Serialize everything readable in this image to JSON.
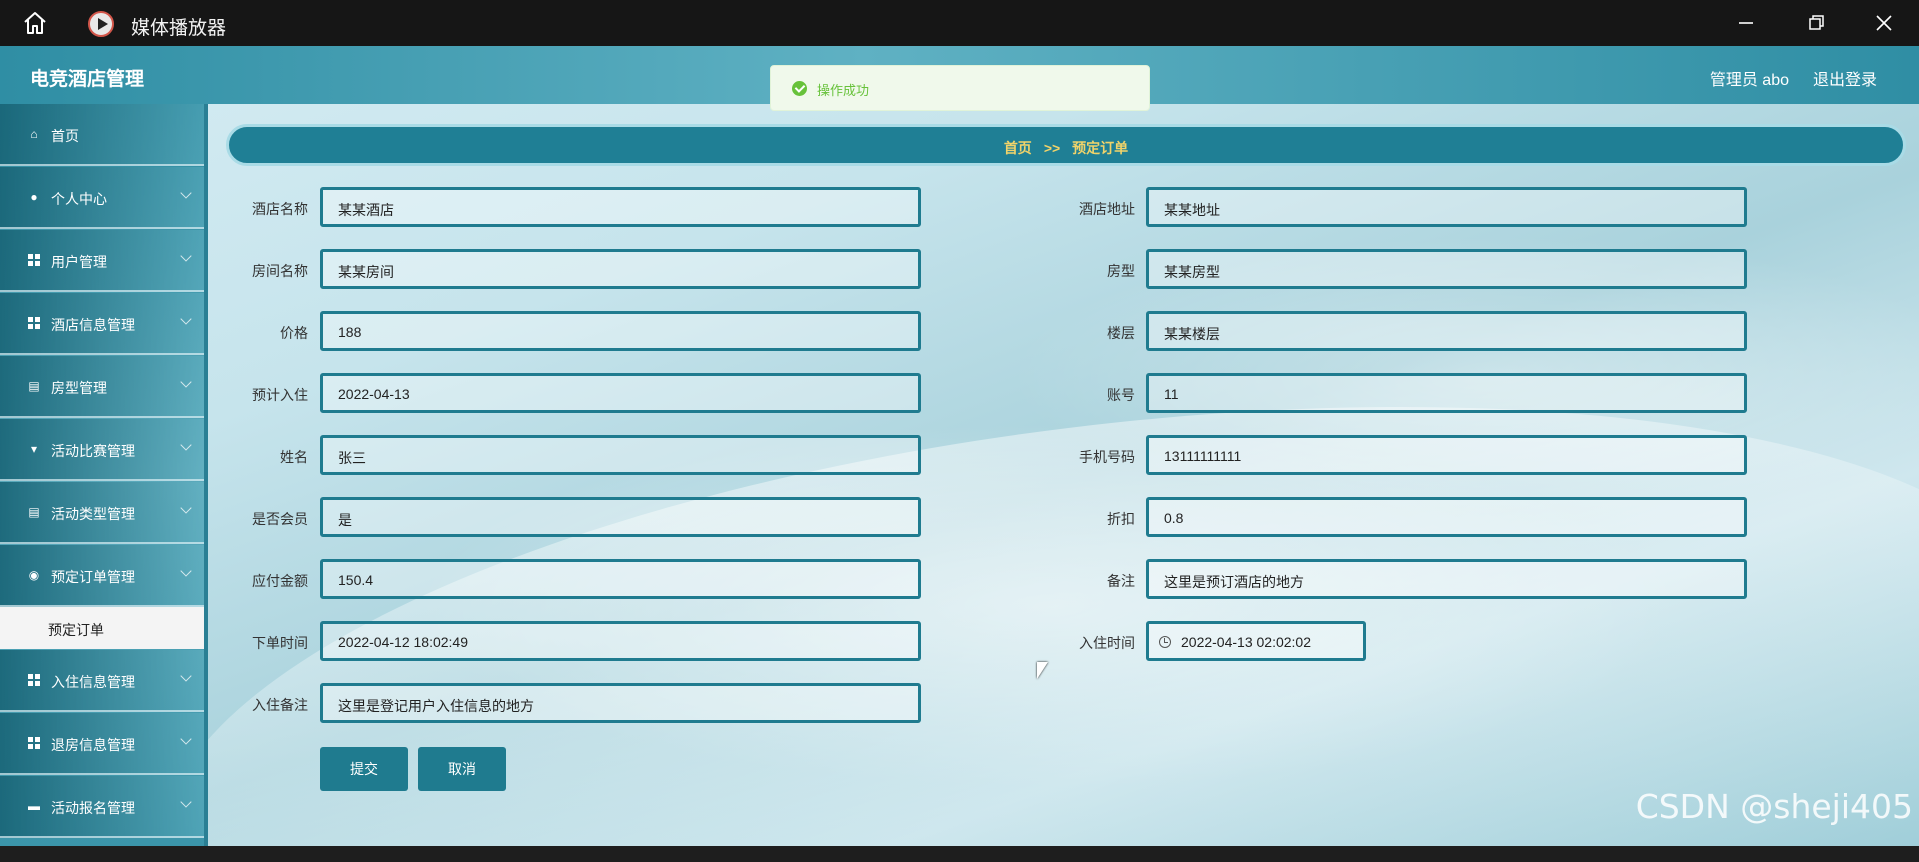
{
  "window": {
    "title": "媒体播放器",
    "home_icon": "home-icon",
    "player_icon": "media-player-icon"
  },
  "app": {
    "brand": "电竞酒店管理",
    "user": "管理员 abo",
    "logout": "退出登录"
  },
  "toast": {
    "message": "操作成功",
    "icon": "success-check-icon",
    "color": "#67c23a"
  },
  "sidebar": {
    "items": [
      {
        "label": "首页",
        "icon": "home-icon",
        "chevron": false
      },
      {
        "label": "个人中心",
        "icon": "user-icon",
        "chevron": true
      },
      {
        "label": "用户管理",
        "icon": "grid-icon",
        "chevron": true
      },
      {
        "label": "酒店信息管理",
        "icon": "grid-icon",
        "chevron": true
      },
      {
        "label": "房型管理",
        "icon": "clipboard-icon",
        "chevron": true
      },
      {
        "label": "活动比赛管理",
        "icon": "trophy-icon",
        "chevron": true
      },
      {
        "label": "活动类型管理",
        "icon": "clipboard-icon",
        "chevron": true
      },
      {
        "label": "预定订单管理",
        "icon": "location-icon",
        "chevron": true
      },
      {
        "label": "入住信息管理",
        "icon": "grid-icon",
        "chevron": true
      },
      {
        "label": "退房信息管理",
        "icon": "grid-icon",
        "chevron": true
      },
      {
        "label": "活动报名管理",
        "icon": "cup-icon",
        "chevron": true
      }
    ],
    "active_submenu": "预定订单"
  },
  "breadcrumb": {
    "home": "首页",
    "separator": ">>",
    "current": "预定订单"
  },
  "form": {
    "hotel_name": {
      "label": "酒店名称",
      "value": "某某酒店"
    },
    "hotel_address": {
      "label": "酒店地址",
      "value": "某某地址"
    },
    "room_name": {
      "label": "房间名称",
      "value": "某某房间"
    },
    "room_type": {
      "label": "房型",
      "value": "某某房型"
    },
    "price": {
      "label": "价格",
      "value": "188"
    },
    "floor": {
      "label": "楼层",
      "value": "某某楼层"
    },
    "checkin_date": {
      "label": "预计入住",
      "value": "2022-04-13"
    },
    "account": {
      "label": "账号",
      "value": "11"
    },
    "name": {
      "label": "姓名",
      "value": "张三"
    },
    "phone": {
      "label": "手机号码",
      "value": "13111111111"
    },
    "is_member": {
      "label": "是否会员",
      "value": "是"
    },
    "discount": {
      "label": "折扣",
      "value": "0.8"
    },
    "amount": {
      "label": "应付金额",
      "value": "150.4"
    },
    "remark": {
      "label": "备注",
      "value": "这里是预订酒店的地方"
    },
    "order_time": {
      "label": "下单时间",
      "value": "2022-04-12 18:02:49"
    },
    "checkin_time": {
      "label": "入住时间",
      "value": "2022-04-13 02:02:02"
    },
    "checkin_remark": {
      "label": "入住备注",
      "value": "这里是登记用户入住信息的地方"
    }
  },
  "buttons": {
    "submit": "提交",
    "cancel": "取消"
  },
  "watermark": "CSDN @sheji405",
  "colors": {
    "primary": "#1f7b8f",
    "breadcrumb_text": "#f0d36a",
    "success": "#67c23a"
  }
}
